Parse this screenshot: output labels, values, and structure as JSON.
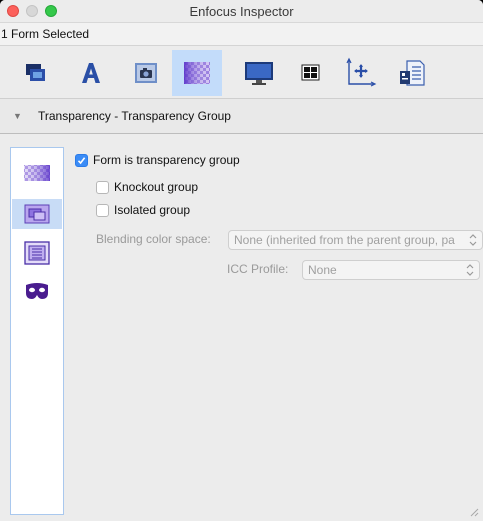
{
  "window": {
    "title": "Enfocus Inspector"
  },
  "status": {
    "selection_text": "1 Form Selected"
  },
  "toolbar": {
    "tools": [
      {
        "icon": "layers-icon"
      },
      {
        "icon": "text-icon"
      },
      {
        "icon": "camera-image-icon"
      },
      {
        "icon": "transparency-icon",
        "active": true
      },
      {
        "icon": "monitor-icon"
      },
      {
        "icon": "color-swatches-icon"
      },
      {
        "icon": "position-axes-icon"
      },
      {
        "icon": "document-properties-icon"
      }
    ]
  },
  "section": {
    "title": "Transparency - Transparency Group"
  },
  "sidebar": {
    "items": [
      {
        "icon": "transparency-checker-icon"
      },
      {
        "icon": "transparency-group-icon",
        "selected": true
      },
      {
        "icon": "knockout-frame-icon"
      },
      {
        "icon": "mask-icon"
      }
    ]
  },
  "options": {
    "form_is_group_label": "Form is transparency group",
    "form_is_group_checked": true,
    "knockout_label": "Knockout group",
    "knockout_checked": false,
    "isolated_label": "Isolated group",
    "isolated_checked": false,
    "blending_label": "Blending color space:",
    "blending_value": "None (inherited from the parent group, pa",
    "icc_label": "ICC Profile:",
    "icc_value": "None"
  },
  "colors": {
    "accent": "#3b8cf6",
    "active_tab": "#c3dcfa",
    "disabled_text": "#9a9a9a"
  }
}
